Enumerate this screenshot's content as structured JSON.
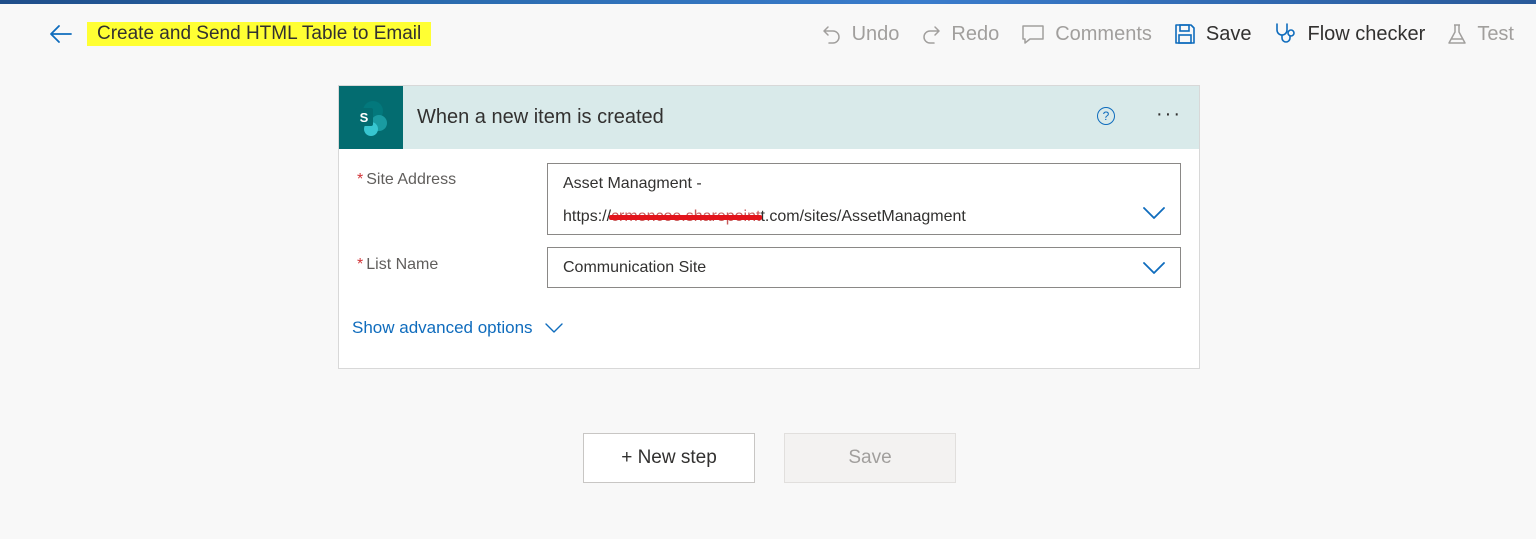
{
  "header": {
    "flow_title": "Create and Send HTML Table to Email",
    "back_icon": "arrow-left-icon",
    "actions": [
      {
        "label": "Undo",
        "icon": "undo-icon",
        "enabled": false
      },
      {
        "label": "Redo",
        "icon": "redo-icon",
        "enabled": false
      },
      {
        "label": "Comments",
        "icon": "comment-icon",
        "enabled": false
      },
      {
        "label": "Save",
        "icon": "save-icon",
        "enabled": true
      },
      {
        "label": "Flow checker",
        "icon": "stethoscope-icon",
        "enabled": true
      },
      {
        "label": "Test",
        "icon": "flask-icon",
        "enabled": false
      }
    ],
    "highlight_color": "#ffff33"
  },
  "trigger": {
    "logo_letter": "S",
    "title": "When a new item is created",
    "help_glyph": "?",
    "more_glyph": "···",
    "header_color": "#d9eaea",
    "logo_color": "#036c70",
    "fields": {
      "site_address": {
        "required_mark": "*",
        "label": "Site Address",
        "value_line1": "Asset Managment -",
        "value_prefix": "https://",
        "value_redacted": "crmoncoe.sharepoint",
        "value_suffix": "t.com/sites/AssetManagment"
      },
      "list_name": {
        "required_mark": "*",
        "label": "List Name",
        "value": "Communication Site"
      }
    },
    "advanced_link": "Show advanced options"
  },
  "footer": {
    "new_step_label": "+ New step",
    "save_label": "Save"
  },
  "colors": {
    "accent": "#0f6cbd",
    "required": "#d13438",
    "disabled_text": "#a19f9d"
  }
}
